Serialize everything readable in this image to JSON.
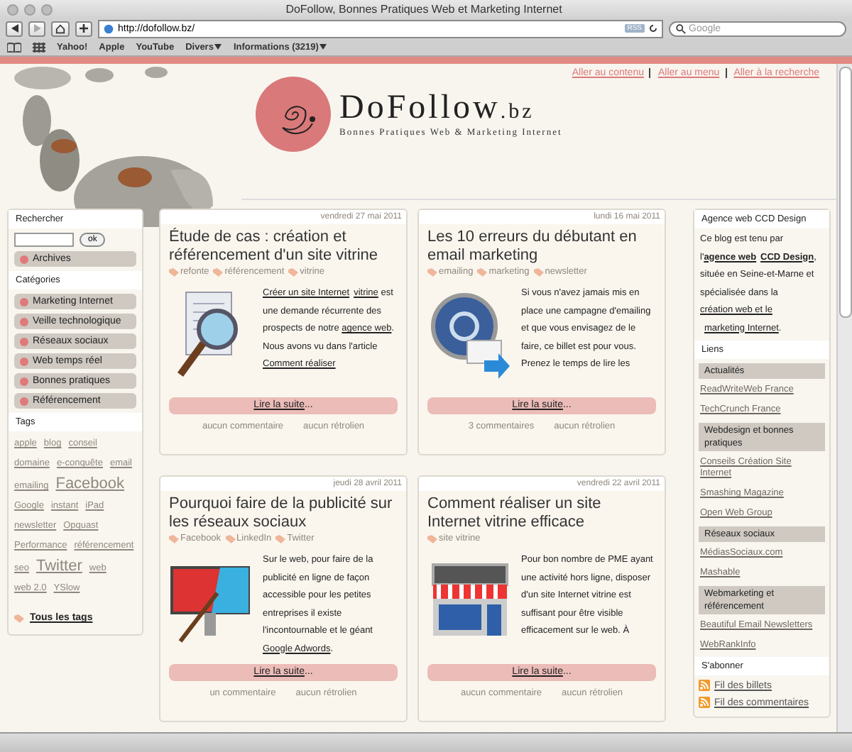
{
  "browser": {
    "title": "DoFollow, Bonnes Pratiques Web et Marketing Internet",
    "address": "http://dofollow.bz/",
    "rss": "RSS",
    "search_placeholder": "Google",
    "bookmarks": [
      {
        "label": "Yahoo!",
        "menu": false
      },
      {
        "label": "Apple",
        "menu": false
      },
      {
        "label": "YouTube",
        "menu": false
      },
      {
        "label": "Divers",
        "menu": true
      },
      {
        "label": "Informations (3219)",
        "menu": true
      }
    ]
  },
  "header": {
    "skip_links": [
      "Aller au contenu",
      "Aller au menu",
      "Aller à la recherche"
    ],
    "logo_name": "DoFollow",
    "logo_tld": ".bz",
    "tagline": "Bonnes Pratiques Web & Marketing Internet"
  },
  "left_sidebar": {
    "search_heading": "Rechercher",
    "search_button": "ok",
    "archives": "Archives",
    "categories_heading": "Catégories",
    "categories": [
      "Marketing Internet",
      "Veille technologique",
      "Réseaux sociaux",
      "Web temps réel",
      "Bonnes pratiques",
      "Référencement"
    ],
    "tags_heading": "Tags",
    "tags": [
      {
        "label": "apple",
        "kind": "small"
      },
      {
        "label": "blog",
        "kind": "small"
      },
      {
        "label": "conseil",
        "kind": "small"
      },
      {
        "label": "domaine",
        "kind": "small"
      },
      {
        "label": "e-conquête",
        "kind": "small"
      },
      {
        "label": "email",
        "kind": "small"
      },
      {
        "label": "emailing",
        "kind": "small"
      },
      {
        "label": "Facebook",
        "kind": "large"
      },
      {
        "label": "Google",
        "kind": "small"
      },
      {
        "label": "instant",
        "kind": "small"
      },
      {
        "label": "iPad",
        "kind": "small"
      },
      {
        "label": "newsletter",
        "kind": "small"
      },
      {
        "label": "Opquast",
        "kind": "small"
      },
      {
        "label": "Performance",
        "kind": "small"
      },
      {
        "label": "référencement",
        "kind": "small"
      },
      {
        "label": "seo",
        "kind": "small"
      },
      {
        "label": "Twitter",
        "kind": "large"
      },
      {
        "label": "web",
        "kind": "small"
      },
      {
        "label": "web 2.0",
        "kind": "small"
      },
      {
        "label": "YSlow",
        "kind": "small"
      }
    ],
    "all_tags": "Tous les tags"
  },
  "posts": [
    {
      "date": "vendredi 27 mai 2011",
      "title": "Étude de cas : création et référencement d'un site vitrine",
      "tags": [
        "refonte",
        "référencement",
        "vitrine"
      ],
      "kind": "magnifier",
      "excerpt": [
        {
          "text": "Créer un site Internet",
          "kind": "link"
        },
        {
          "text": "vitrine",
          "kind": "link"
        },
        {
          "text": " est une demande récurrente des prospects de notre ",
          "kind": "text"
        },
        {
          "text": "agence web",
          "kind": "link"
        },
        {
          "text": ". Nous avons vu dans l'article ",
          "kind": "text"
        },
        {
          "text": "Comment réaliser",
          "kind": "link"
        }
      ],
      "read_more": "Lire la suite",
      "ellipsis": "...",
      "comments": "aucun commentaire",
      "trackbacks": "aucun rétrolien"
    },
    {
      "date": "lundi 16 mai 2011",
      "title": "Les 10 erreurs du débutant en email marketing",
      "tags": [
        "emailing",
        "marketing",
        "newsletter"
      ],
      "kind": "email",
      "excerpt": [
        {
          "text": "Si vous n'avez jamais mis en place une campagne d'emailing et que vous envisagez de le faire, ce billet est pour vous. Prenez le temps de lire les",
          "kind": "text"
        }
      ],
      "read_more": "Lire la suite",
      "ellipsis": "...",
      "comments": "3 commentaires",
      "trackbacks": "aucun rétrolien"
    },
    {
      "date": "jeudi 28 avril 2011",
      "title": "Pourquoi faire de la publicité sur les réseaux sociaux",
      "tags": [
        "Facebook",
        "LinkedIn",
        "Twitter"
      ],
      "kind": "billboard",
      "excerpt": [
        {
          "text": "Sur le web, pour faire de la publicité en ligne de façon accessible pour les petites entreprises il existe l'incontournable et le géant ",
          "kind": "text"
        },
        {
          "text": "Google Adwords",
          "kind": "link"
        },
        {
          "text": ".",
          "kind": "text"
        }
      ],
      "read_more": "Lire la suite",
      "ellipsis": "...",
      "comments": "un commentaire",
      "trackbacks": "aucun rétrolien"
    },
    {
      "date": "vendredi 22 avril 2011",
      "title": "Comment réaliser un site Internet vitrine efficace",
      "tags": [
        "site vitrine"
      ],
      "kind": "shop",
      "excerpt": [
        {
          "text": "Pour bon nombre de PME ayant une activité hors ligne, disposer d'un site Internet vitrine est suffisant pour être visible efficacement sur le web. À",
          "kind": "text"
        }
      ],
      "read_more": "Lire la suite",
      "ellipsis": "...",
      "comments": "aucun commentaire",
      "trackbacks": "aucun rétrolien"
    }
  ],
  "right_sidebar": {
    "agency_heading": "Agence web CCD Design",
    "agency_text": [
      {
        "text": "Ce blog est tenu par l'",
        "kind": "text"
      },
      {
        "text": "agence web",
        "kind": "bold_link"
      },
      {
        "text": "CCD Design",
        "kind": "bold_link"
      },
      {
        "text": ", située en Seine-et-Marne et spécialisée dans la ",
        "kind": "text"
      },
      {
        "text": "création web et le",
        "kind": "link"
      },
      {
        "text": "marketing Internet",
        "kind": "link"
      },
      {
        "text": ".",
        "kind": "text"
      }
    ],
    "links_heading": "Liens",
    "link_groups": [
      {
        "title": "Actualités",
        "links": [
          "ReadWriteWeb France",
          "TechCrunch France"
        ]
      },
      {
        "title": "Webdesign et bonnes pratiques",
        "links": [
          "Conseils Création Site Internet",
          "Smashing Magazine",
          "Open Web Group"
        ]
      },
      {
        "title": "Réseaux sociaux",
        "links": [
          "MédiasSociaux.com",
          "Mashable"
        ]
      },
      {
        "title": "Webmarketing et référencement",
        "links": [
          "Beautiful Email Newsletters",
          "WebRankInfo"
        ]
      }
    ],
    "subscribe_heading": "S'abonner",
    "feeds": [
      "Fil des billets",
      "Fil des commentaires"
    ]
  }
}
